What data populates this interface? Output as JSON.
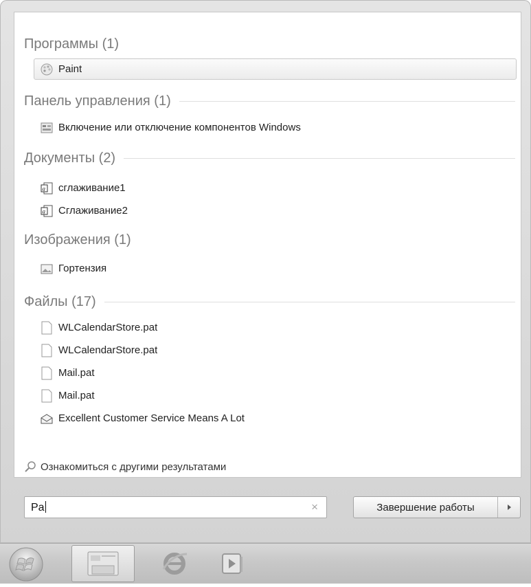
{
  "start_menu": {
    "groups": [
      {
        "title": "Программы (1)",
        "items": [
          {
            "label": "Paint",
            "icon": "paint-icon"
          }
        ]
      },
      {
        "title": "Панель управления (1)",
        "items": [
          {
            "label": "Включение или отключение компонентов Windows",
            "icon": "control-panel-icon"
          }
        ]
      },
      {
        "title": "Документы (2)",
        "items": [
          {
            "label": "сглаживание1",
            "icon": "document-icon"
          },
          {
            "label": "Сглаживание2",
            "icon": "document-icon"
          }
        ]
      },
      {
        "title": "Изображения (1)",
        "items": [
          {
            "label": "Гортензия",
            "icon": "image-icon"
          }
        ]
      },
      {
        "title": "Файлы (17)",
        "items": [
          {
            "label": "WLCalendarStore.pat",
            "icon": "file-icon"
          },
          {
            "label": "WLCalendarStore.pat",
            "icon": "file-icon"
          },
          {
            "label": "Mail.pat",
            "icon": "file-icon"
          },
          {
            "label": "Mail.pat",
            "icon": "file-icon"
          },
          {
            "label": "Excellent Customer Service Means A Lot",
            "icon": "mail-icon"
          }
        ]
      }
    ],
    "more_results": "Ознакомиться с другими результатами",
    "search": {
      "value": "Pa",
      "clear_glyph": "×"
    },
    "shutdown": {
      "label": "Завершение работы"
    }
  },
  "taskbar": {
    "buttons": [
      {
        "name": "start-button",
        "icon": "windows-logo-icon"
      },
      {
        "name": "explorer-button",
        "icon": "folder-icon",
        "active": true
      },
      {
        "name": "internet-explorer-button",
        "icon": "internet-explorer-icon"
      },
      {
        "name": "media-player-button",
        "icon": "media-player-icon"
      }
    ]
  },
  "colors": {
    "selected_item_bg": "#ececec",
    "group_header": "#7a7a7a",
    "frame": "#d3d3d3"
  }
}
